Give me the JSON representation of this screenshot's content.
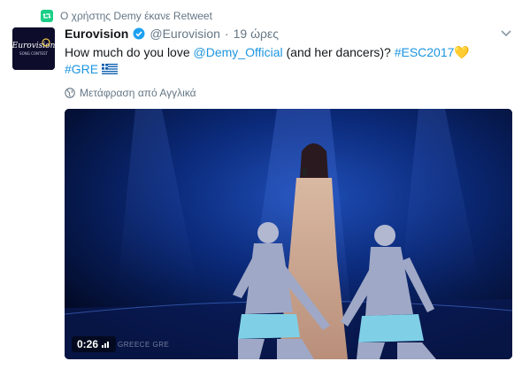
{
  "retweet_context": {
    "text": "Ο χρήστης Demy έκανε Retweet"
  },
  "tweet": {
    "author_name": "Eurovision",
    "handle": "@Eurovision",
    "separator": "·",
    "time": "19 ώρες",
    "text_parts": {
      "p1": "How much do you love ",
      "mention": "@Demy_Official",
      "p2": " (and her dancers)? ",
      "hashtag1": "#ESC2017",
      "heart": "💛",
      "hashtag2": "#GRE"
    },
    "translate_label": "Μετάφραση από Αγγλικά"
  },
  "avatar": {
    "line1": "Eurovision",
    "line2": "SONG CONTEST"
  },
  "video": {
    "duration": "0:26",
    "watermark": "GREECE GRE"
  },
  "colors": {
    "link": "#1b95e0",
    "retweet_green": "#19cf86",
    "verified_blue": "#1da1f2"
  }
}
